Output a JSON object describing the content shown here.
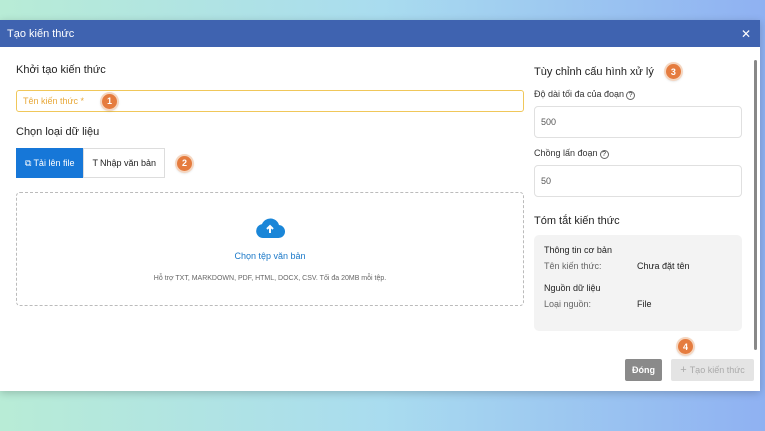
{
  "modal": {
    "title": "Tạo kiến thức",
    "close_icon": "close-icon"
  },
  "left": {
    "section_title": "Khởi tạo kiến thức",
    "name_placeholder": "Tên kiến thức *",
    "data_type_title": "Chọn loại dữ liệu",
    "tabs": [
      {
        "label": "Tải lên file",
        "icon": "file-copy-icon",
        "active": true
      },
      {
        "label": "Nhập văn bản",
        "icon": "text-icon",
        "active": false
      }
    ],
    "upload": {
      "icon": "cloud-upload-icon",
      "link": "Chọn tệp văn bản",
      "hint": "Hỗ trợ TXT, MARKDOWN, PDF, HTML, DOCX, CSV. Tối đa 20MB mỗi tệp."
    }
  },
  "right": {
    "section_title": "Tùy chỉnh cấu hình xử lý",
    "chunk_size_label": "Độ dài tối đa của đoạn",
    "chunk_size": "500",
    "overlap_label": "Chồng lấn đoạn",
    "overlap": "50",
    "summary_title": "Tóm tắt kiến thức",
    "basic_title": "Thông tin cơ bản",
    "name_key": "Tên kiến thức:",
    "name_val": "Chưa đặt tên",
    "source_title": "Nguồn dữ liệu",
    "source_key": "Loại nguồn:",
    "source_val": "File"
  },
  "footer": {
    "close": "Đóng",
    "create": "Tạo kiến thức"
  },
  "badges": [
    "1",
    "2",
    "3",
    "4"
  ],
  "colors": {
    "header": "#3f63b0",
    "primary": "#1677d8",
    "badge": "#e57c3f",
    "required_border": "#f0c75a"
  }
}
